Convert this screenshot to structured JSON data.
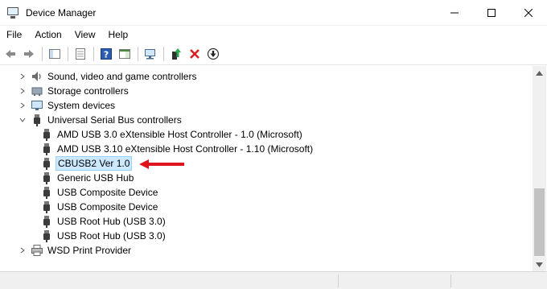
{
  "window": {
    "title": "Device Manager",
    "minimize": "—",
    "maximize": "☐",
    "close": "✕"
  },
  "menu": [
    "File",
    "Action",
    "View",
    "Help"
  ],
  "toolbar": {
    "icons": [
      "back-icon",
      "forward-icon",
      "show-hide-console-tree-icon",
      "properties-icon",
      "help-icon",
      "show-action-pane-icon",
      "scan-hardware-icon",
      "update-driver-icon",
      "uninstall-device-icon",
      "disable-device-icon"
    ]
  },
  "tree": {
    "categories_top": [
      {
        "label": "Sound, video and game controllers",
        "expanded": false
      },
      {
        "label": "Storage controllers",
        "expanded": false
      },
      {
        "label": "System devices",
        "expanded": false
      },
      {
        "label": "Universal Serial Bus controllers",
        "expanded": true
      }
    ],
    "usb_children": [
      {
        "label": "AMD USB 3.0 eXtensible Host Controller - 1.0 (Microsoft)",
        "selected": false
      },
      {
        "label": "AMD USB 3.10 eXtensible Host Controller - 1.10 (Microsoft)",
        "selected": false
      },
      {
        "label": "CBUSB2 Ver 1.0",
        "selected": true
      },
      {
        "label": "Generic USB Hub",
        "selected": false
      },
      {
        "label": "USB Composite Device",
        "selected": false
      },
      {
        "label": "USB Composite Device",
        "selected": false
      },
      {
        "label": "USB Root Hub (USB 3.0)",
        "selected": false
      },
      {
        "label": "USB Root Hub (USB 3.0)",
        "selected": false
      }
    ],
    "categories_bottom": [
      {
        "label": "WSD Print Provider",
        "expanded": false
      }
    ]
  },
  "annotation": {
    "arrow_color": "#e0141e",
    "points_to": "CBUSB2 Ver 1.0"
  },
  "colors": {
    "selection_bg": "#cce8ff",
    "selection_border": "#99d1ff"
  }
}
